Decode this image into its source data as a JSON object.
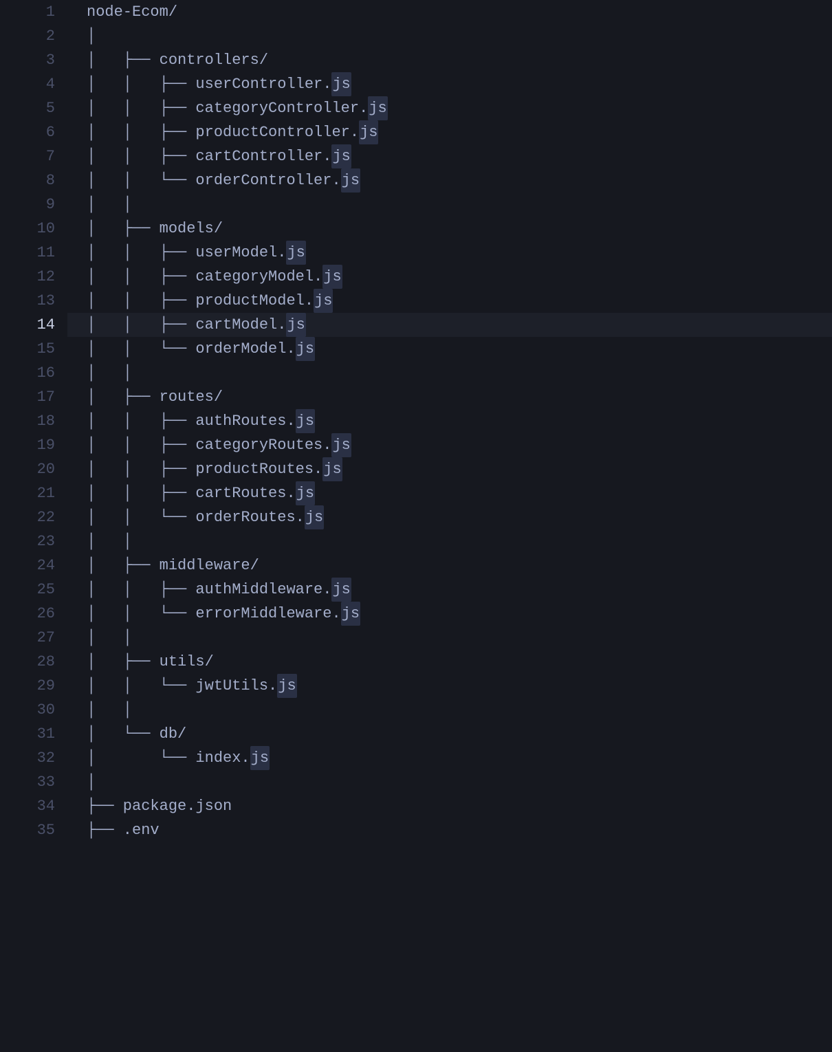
{
  "editor": {
    "active_line": 14,
    "lines": [
      {
        "num": 1,
        "segments": [
          {
            "t": "node-Ecom/",
            "hl": false
          }
        ]
      },
      {
        "num": 2,
        "segments": [
          {
            "t": "│",
            "hl": false
          }
        ]
      },
      {
        "num": 3,
        "segments": [
          {
            "t": "│   ├── controllers/",
            "hl": false
          }
        ]
      },
      {
        "num": 4,
        "segments": [
          {
            "t": "│   │   ├── userController.",
            "hl": false
          },
          {
            "t": "js",
            "hl": true
          }
        ]
      },
      {
        "num": 5,
        "segments": [
          {
            "t": "│   │   ├── categoryController.",
            "hl": false
          },
          {
            "t": "js",
            "hl": true
          }
        ]
      },
      {
        "num": 6,
        "segments": [
          {
            "t": "│   │   ├── productController.",
            "hl": false
          },
          {
            "t": "js",
            "hl": true
          }
        ]
      },
      {
        "num": 7,
        "segments": [
          {
            "t": "│   │   ├── cartController.",
            "hl": false
          },
          {
            "t": "js",
            "hl": true
          }
        ]
      },
      {
        "num": 8,
        "segments": [
          {
            "t": "│   │   └── orderController.",
            "hl": false
          },
          {
            "t": "js",
            "hl": true
          }
        ]
      },
      {
        "num": 9,
        "segments": [
          {
            "t": "│   │",
            "hl": false
          }
        ]
      },
      {
        "num": 10,
        "segments": [
          {
            "t": "│   ├── models/",
            "hl": false
          }
        ]
      },
      {
        "num": 11,
        "segments": [
          {
            "t": "│   │   ├── userModel.",
            "hl": false
          },
          {
            "t": "js",
            "hl": true
          }
        ]
      },
      {
        "num": 12,
        "segments": [
          {
            "t": "│   │   ├── categoryModel.",
            "hl": false
          },
          {
            "t": "js",
            "hl": true
          }
        ]
      },
      {
        "num": 13,
        "segments": [
          {
            "t": "│   │   ├── productModel.",
            "hl": false
          },
          {
            "t": "js",
            "hl": true
          }
        ]
      },
      {
        "num": 14,
        "segments": [
          {
            "t": "│   │   ├── cartModel.",
            "hl": false
          },
          {
            "t": "js",
            "hl": true
          }
        ]
      },
      {
        "num": 15,
        "segments": [
          {
            "t": "│   │   └── orderModel.",
            "hl": false
          },
          {
            "t": "js",
            "hl": true
          }
        ]
      },
      {
        "num": 16,
        "segments": [
          {
            "t": "│   │",
            "hl": false
          }
        ]
      },
      {
        "num": 17,
        "segments": [
          {
            "t": "│   ├── routes/",
            "hl": false
          }
        ]
      },
      {
        "num": 18,
        "segments": [
          {
            "t": "│   │   ├── authRoutes.",
            "hl": false
          },
          {
            "t": "js",
            "hl": true
          }
        ]
      },
      {
        "num": 19,
        "segments": [
          {
            "t": "│   │   ├── categoryRoutes.",
            "hl": false
          },
          {
            "t": "js",
            "hl": true
          }
        ]
      },
      {
        "num": 20,
        "segments": [
          {
            "t": "│   │   ├── productRoutes.",
            "hl": false
          },
          {
            "t": "js",
            "hl": true
          }
        ]
      },
      {
        "num": 21,
        "segments": [
          {
            "t": "│   │   ├── cartRoutes.",
            "hl": false
          },
          {
            "t": "js",
            "hl": true
          }
        ]
      },
      {
        "num": 22,
        "segments": [
          {
            "t": "│   │   └── orderRoutes.",
            "hl": false
          },
          {
            "t": "js",
            "hl": true
          }
        ]
      },
      {
        "num": 23,
        "segments": [
          {
            "t": "│   │",
            "hl": false
          }
        ]
      },
      {
        "num": 24,
        "segments": [
          {
            "t": "│   ├── middleware/",
            "hl": false
          }
        ]
      },
      {
        "num": 25,
        "segments": [
          {
            "t": "│   │   ├── authMiddleware.",
            "hl": false
          },
          {
            "t": "js",
            "hl": true
          }
        ]
      },
      {
        "num": 26,
        "segments": [
          {
            "t": "│   │   └── errorMiddleware.",
            "hl": false
          },
          {
            "t": "js",
            "hl": true
          }
        ]
      },
      {
        "num": 27,
        "segments": [
          {
            "t": "│   │",
            "hl": false
          }
        ]
      },
      {
        "num": 28,
        "segments": [
          {
            "t": "│   ├── utils/",
            "hl": false
          }
        ]
      },
      {
        "num": 29,
        "segments": [
          {
            "t": "│   │   └── jwtUtils.",
            "hl": false
          },
          {
            "t": "js",
            "hl": true
          }
        ]
      },
      {
        "num": 30,
        "segments": [
          {
            "t": "│   │",
            "hl": false
          }
        ]
      },
      {
        "num": 31,
        "segments": [
          {
            "t": "│   └── db/",
            "hl": false
          }
        ]
      },
      {
        "num": 32,
        "segments": [
          {
            "t": "│       └── index.",
            "hl": false
          },
          {
            "t": "js",
            "hl": true
          }
        ]
      },
      {
        "num": 33,
        "segments": [
          {
            "t": "│",
            "hl": false
          }
        ]
      },
      {
        "num": 34,
        "segments": [
          {
            "t": "├── package.json",
            "hl": false
          }
        ]
      },
      {
        "num": 35,
        "segments": [
          {
            "t": "├── .env",
            "hl": false
          }
        ]
      }
    ]
  }
}
